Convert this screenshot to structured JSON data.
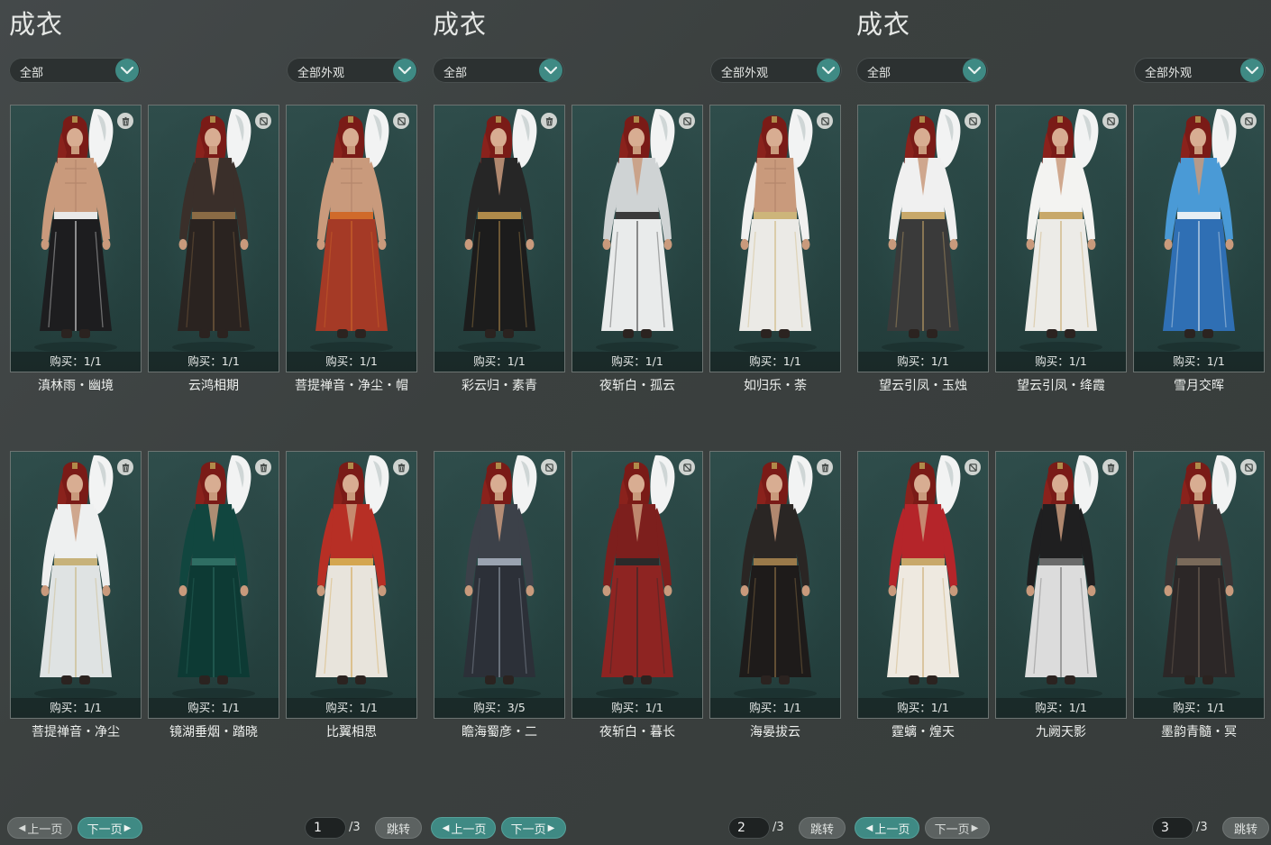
{
  "panels": [
    {
      "title": "成衣",
      "category_filter": "全部",
      "look_filter": "全部外观",
      "items": [
        {
          "name": "滇林雨・幽境",
          "buy": "购买：1/1",
          "icon": "trash-icon",
          "outfit": "bare-black"
        },
        {
          "name": "云鸿相期",
          "buy": "购买：1/1",
          "icon": "no-entry-icon",
          "outfit": "dark-brown"
        },
        {
          "name": "菩提禅音・净尘・帽",
          "buy": "购买：1/1",
          "icon": "no-entry-icon",
          "outfit": "bare-red"
        },
        {
          "name": "菩提禅音・净尘",
          "buy": "购买：1/1",
          "icon": "trash-icon",
          "outfit": "white-robe"
        },
        {
          "name": "镜湖垂烟・踏晓",
          "buy": "购买：1/1",
          "icon": "trash-icon",
          "outfit": "green-robe"
        },
        {
          "name": "比翼相思",
          "buy": "购买：1/1",
          "icon": "trash-icon",
          "outfit": "red-white"
        }
      ],
      "prev_label": "上一页",
      "next_label": "下一页",
      "prev_enabled": false,
      "next_enabled": true,
      "page": "1",
      "total": "/3",
      "jump_label": "跳转"
    },
    {
      "title": "成衣",
      "category_filter": "全部",
      "look_filter": "全部外观",
      "items": [
        {
          "name": "彩云归・素青",
          "buy": "购买：1/1",
          "icon": "trash-icon",
          "outfit": "black-gold"
        },
        {
          "name": "夜斩白・孤云",
          "buy": "购买：1/1",
          "icon": "no-entry-icon",
          "outfit": "silver-armor"
        },
        {
          "name": "如归乐・荼",
          "buy": "购买：1/1",
          "icon": "no-entry-icon",
          "outfit": "white-open"
        },
        {
          "name": "瞻海蜀彦・二",
          "buy": "购买：3/5",
          "icon": "no-entry-icon",
          "outfit": "grey-armor"
        },
        {
          "name": "夜斩白・暮长",
          "buy": "购买：1/1",
          "icon": "no-entry-icon",
          "outfit": "red-armor"
        },
        {
          "name": "海晏拔云",
          "buy": "购买：1/1",
          "icon": "trash-icon",
          "outfit": "black-robe"
        }
      ],
      "prev_label": "上一页",
      "next_label": "下一页",
      "prev_enabled": true,
      "next_enabled": true,
      "page": "2",
      "total": "/3",
      "jump_label": "跳转"
    },
    {
      "title": "成衣",
      "category_filter": "全部",
      "look_filter": "全部外观",
      "items": [
        {
          "name": "望云引凤・玉烛",
          "buy": "购买：1/1",
          "icon": "no-entry-icon",
          "outfit": "white-fade"
        },
        {
          "name": "望云引凤・绛霞",
          "buy": "购买：1/1",
          "icon": "no-entry-icon",
          "outfit": "white-long"
        },
        {
          "name": "雪月交晖",
          "buy": "购买：1/1",
          "icon": "no-entry-icon",
          "outfit": "blue-robe"
        },
        {
          "name": "霆螭・煌天",
          "buy": "购买：1/1",
          "icon": "no-entry-icon",
          "outfit": "red-white-coat"
        },
        {
          "name": "九阙天影",
          "buy": "购买：1/1",
          "icon": "trash-icon",
          "outfit": "black-white"
        },
        {
          "name": "墨韵青髓・冥",
          "buy": "购买：1/1",
          "icon": "no-entry-icon",
          "outfit": "dark-grey"
        }
      ],
      "prev_label": "上一页",
      "next_label": "下一页",
      "prev_enabled": true,
      "next_enabled": false,
      "page": "3",
      "total": "/3",
      "jump_label": "跳转"
    }
  ],
  "colors": {
    "accent": "#3f8a84",
    "card_bg": "#284543",
    "page_bg": "#3b403f"
  }
}
